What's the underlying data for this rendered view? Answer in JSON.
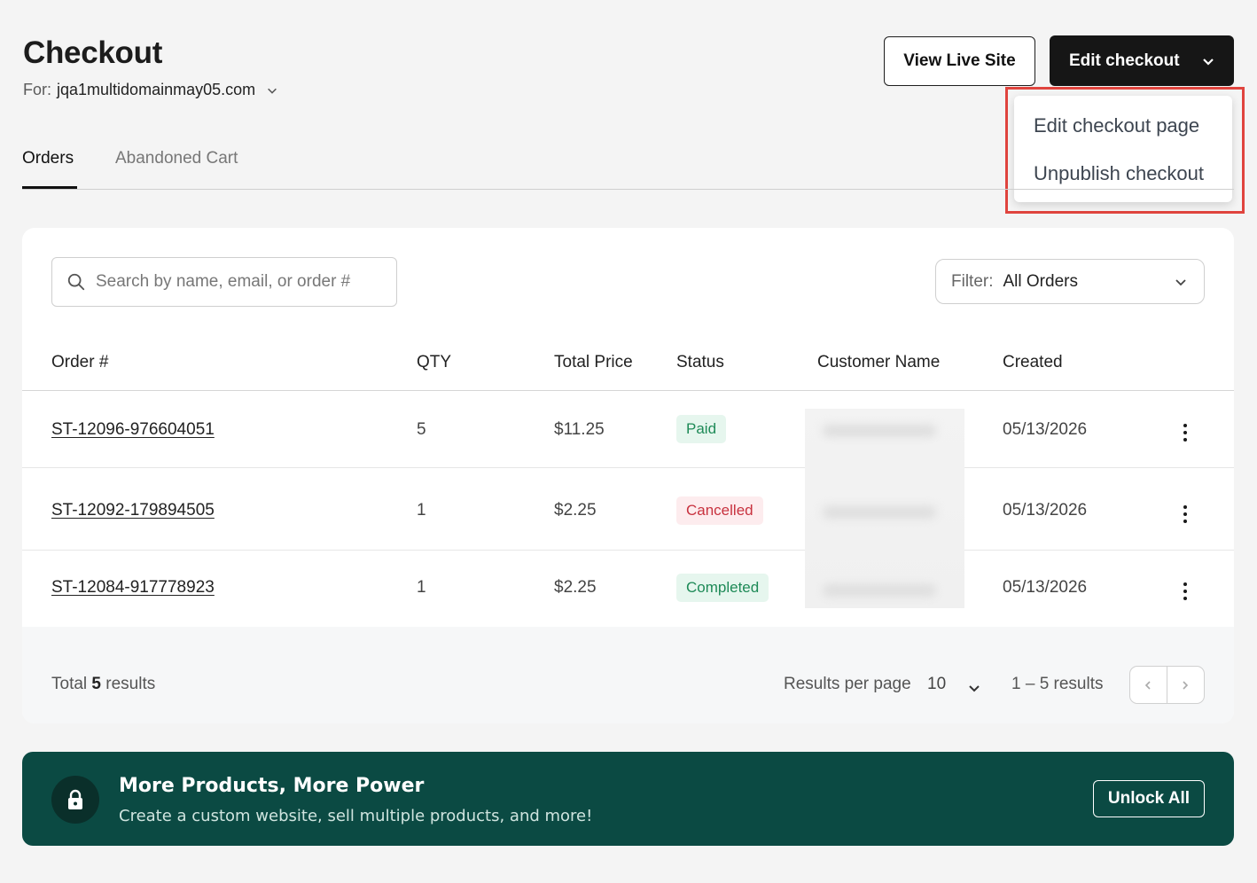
{
  "header": {
    "title": "Checkout",
    "for_label": "For:",
    "domain": "jqa1multidomainmay05.com",
    "view_live_label": "View Live Site",
    "edit_checkout_label": "Edit checkout"
  },
  "edit_menu": {
    "items": [
      "Edit checkout page",
      "Unpublish checkout"
    ]
  },
  "tabs": [
    {
      "label": "Orders",
      "active": true
    },
    {
      "label": "Abandoned Cart",
      "active": false
    }
  ],
  "search": {
    "placeholder": "Search by name, email, or order #"
  },
  "filter": {
    "label": "Filter:",
    "value": "All Orders"
  },
  "table": {
    "columns": [
      "Order #",
      "QTY",
      "Total Price",
      "Status",
      "Customer Name",
      "Created"
    ],
    "rows": [
      {
        "order": "ST-12096-976604051",
        "qty": "5",
        "total": "$11.25",
        "status": "Paid",
        "customer": "",
        "created": "05/13/2026"
      },
      {
        "order": "ST-12092-179894505",
        "qty": "1",
        "total": "$2.25",
        "status": "Cancelled",
        "customer": "",
        "created": "05/13/2026"
      },
      {
        "order": "ST-12084-917778923",
        "qty": "1",
        "total": "$2.25",
        "status": "Completed",
        "customer": "",
        "created": "05/13/2026"
      }
    ]
  },
  "footer": {
    "total_prefix": "Total",
    "total_count": "5",
    "total_suffix": "results",
    "results_per_page_label": "Results per page",
    "results_per_page_value": "10",
    "range": "1 – 5 results"
  },
  "banner": {
    "title": "More Products, More Power",
    "subtitle": "Create a custom website, sell multiple products, and more!",
    "button_label": "Unlock All"
  },
  "colors": {
    "primary_dark": "#161616",
    "banner_bg": "#0b4a43",
    "highlight_red": "#e0443e",
    "status_paid": "#1e8a57",
    "status_cancelled": "#c8323f"
  }
}
